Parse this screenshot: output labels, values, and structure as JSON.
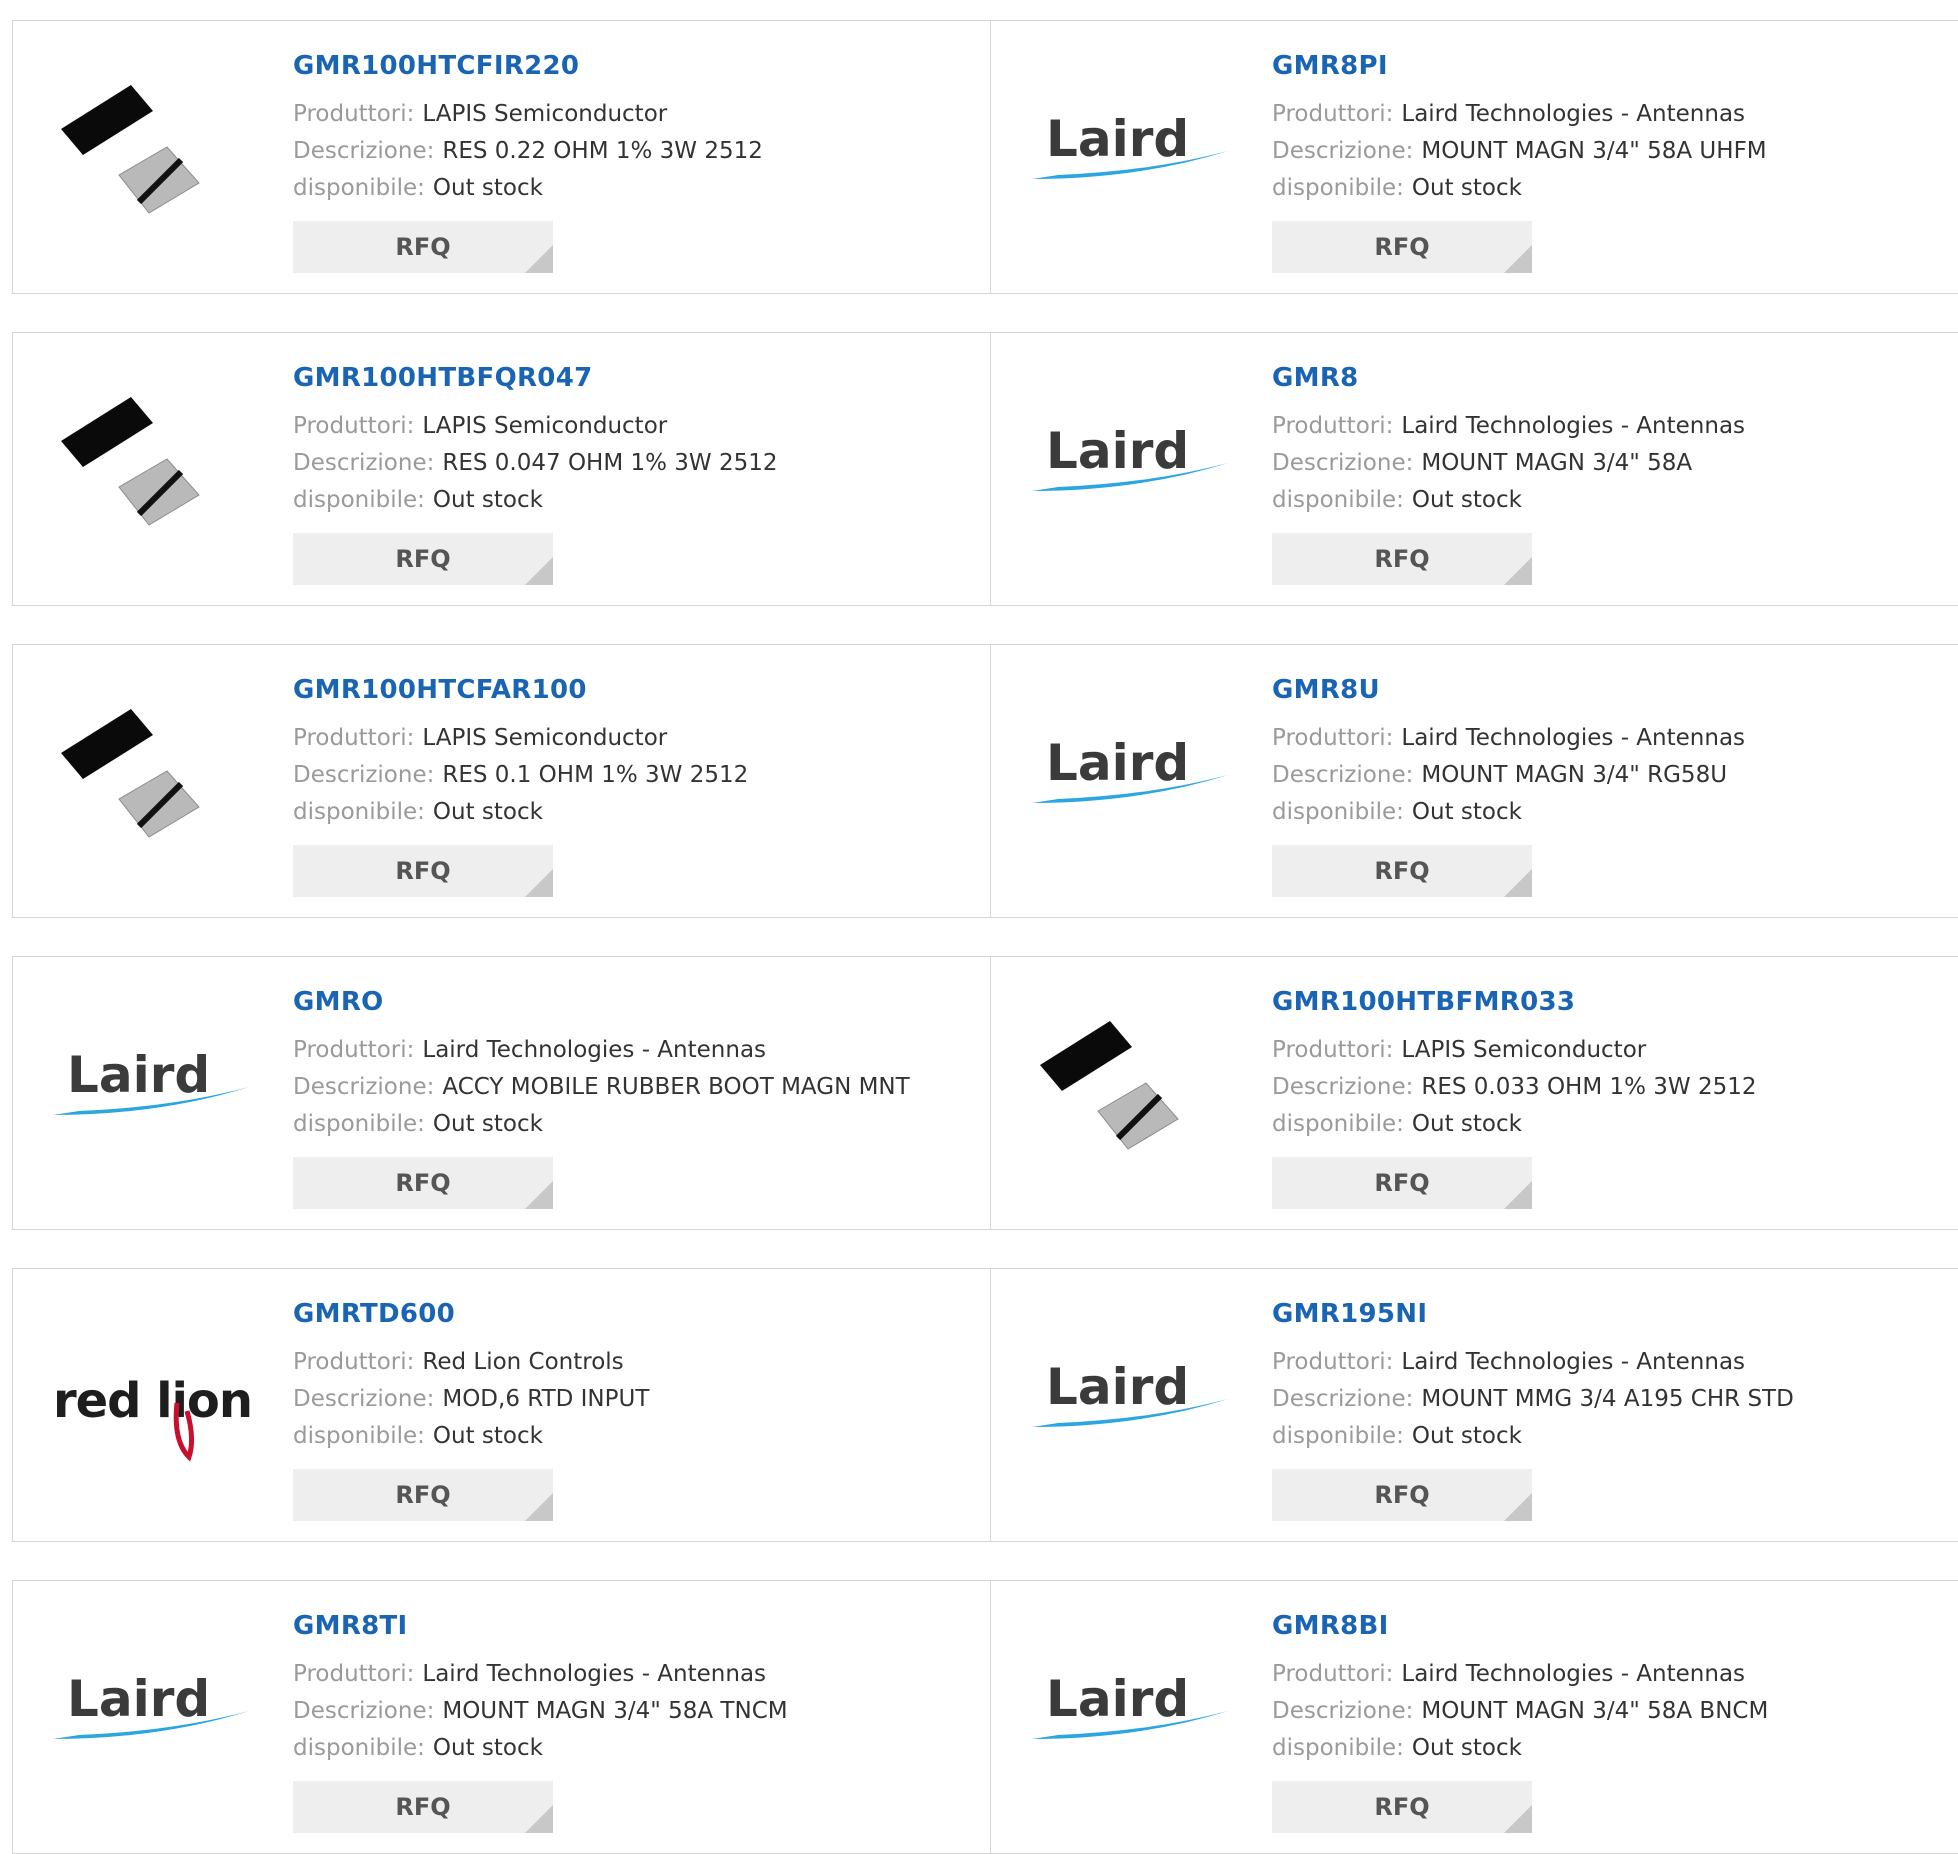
{
  "labels": {
    "manufacturer": "Produttori:",
    "description": "Descrizione:",
    "availability": "disponibile:",
    "rfq": "RFQ"
  },
  "rows": [
    [
      {
        "part": "GMR100HTCFIR220",
        "manufacturer": "LAPIS Semiconductor",
        "description": "RES 0.22 OHM 1% 3W 2512",
        "availability": "Out stock",
        "logo": "resistor-icon"
      },
      {
        "part": "GMR8PI",
        "manufacturer": "Laird Technologies - Antennas",
        "description": "MOUNT MAGN 3/4\" 58A UHFM",
        "availability": "Out stock",
        "logo": "laird-logo",
        "logo_text": "Laird"
      }
    ],
    [
      {
        "part": "GMR100HTBFQR047",
        "manufacturer": "LAPIS Semiconductor",
        "description": "RES 0.047 OHM 1% 3W 2512",
        "availability": "Out stock",
        "logo": "resistor-icon"
      },
      {
        "part": "GMR8",
        "manufacturer": "Laird Technologies - Antennas",
        "description": "MOUNT MAGN 3/4\" 58A",
        "availability": "Out stock",
        "logo": "laird-logo",
        "logo_text": "Laird"
      }
    ],
    [
      {
        "part": "GMR100HTCFAR100",
        "manufacturer": "LAPIS Semiconductor",
        "description": "RES 0.1 OHM 1% 3W 2512",
        "availability": "Out stock",
        "logo": "resistor-icon"
      },
      {
        "part": "GMR8U",
        "manufacturer": "Laird Technologies - Antennas",
        "description": "MOUNT MAGN 3/4\" RG58U",
        "availability": "Out stock",
        "logo": "laird-logo",
        "logo_text": "Laird"
      }
    ],
    [
      {
        "part": "GMRO",
        "manufacturer": "Laird Technologies - Antennas",
        "description": "ACCY MOBILE RUBBER BOOT MAGN MNT",
        "availability": "Out stock",
        "logo": "laird-logo",
        "logo_text": "Laird"
      },
      {
        "part": "GMR100HTBFMR033",
        "manufacturer": "LAPIS Semiconductor",
        "description": "RES 0.033 OHM 1% 3W 2512",
        "availability": "Out stock",
        "logo": "resistor-icon"
      }
    ],
    [
      {
        "part": "GMRTD600",
        "manufacturer": "Red Lion Controls",
        "description": "MOD,6 RTD INPUT",
        "availability": "Out stock",
        "logo": "redlion-logo",
        "logo_text": "red lion"
      },
      {
        "part": "GMR195NI",
        "manufacturer": "Laird Technologies - Antennas",
        "description": "MOUNT MMG 3/4 A195 CHR STD",
        "availability": "Out stock",
        "logo": "laird-logo",
        "logo_text": "Laird"
      }
    ],
    [
      {
        "part": "GMR8TI",
        "manufacturer": "Laird Technologies - Antennas",
        "description": "MOUNT MAGN 3/4\" 58A TNCM",
        "availability": "Out stock",
        "logo": "laird-logo",
        "logo_text": "Laird"
      },
      {
        "part": "GMR8BI",
        "manufacturer": "Laird Technologies - Antennas",
        "description": "MOUNT MAGN 3/4\" 58A BNCM",
        "availability": "Out stock",
        "logo": "laird-logo",
        "logo_text": "Laird"
      }
    ]
  ],
  "colors": {
    "part_link": "#1a64b4",
    "label": "#9a9a9a",
    "value": "#333333",
    "laird_swoosh": "#2aa6e0",
    "redlion_red": "#c8102e"
  }
}
